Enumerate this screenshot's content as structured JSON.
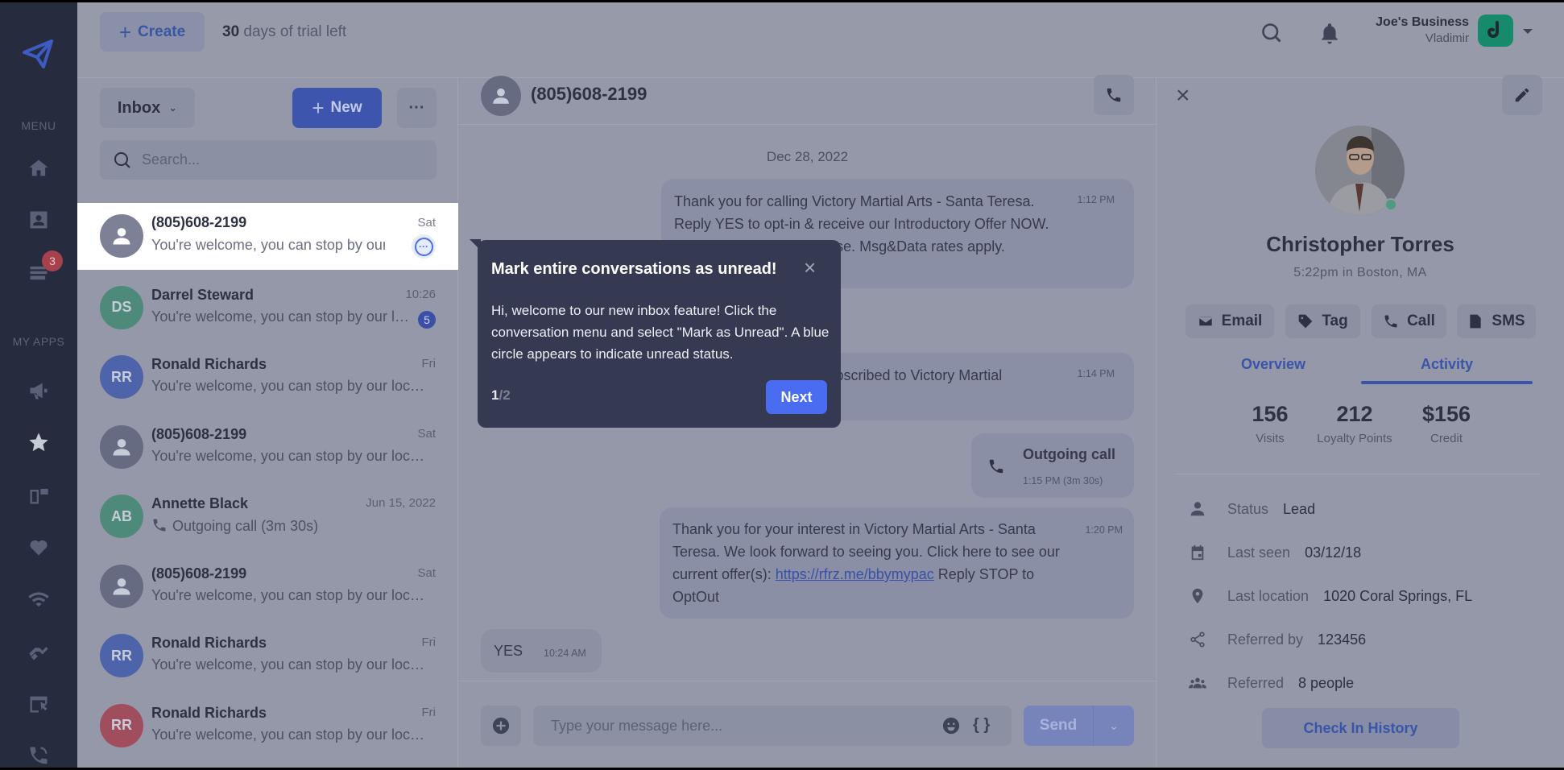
{
  "header": {
    "create_label": "Create",
    "trial_count": "30",
    "trial_text": "days of trial left",
    "business": "Joe's Business",
    "user": "Vladimir"
  },
  "sidebar": {
    "menu_label": "MENU",
    "apps_label": "MY APPS",
    "menu_icons": [
      "home-icon",
      "contacts-icon",
      "inbox-icon"
    ],
    "inbox_badge": "3",
    "app_icons": [
      "megaphone-icon",
      "star-icon",
      "devices-icon",
      "heart-icon",
      "wifi-icon",
      "handshake-icon",
      "browser-click-icon",
      "phone-callback-icon"
    ]
  },
  "inbox": {
    "folder_label": "Inbox",
    "new_label": "New",
    "search_placeholder": "Search...",
    "conversations": [
      {
        "name": "(805)608-2199",
        "preview": "You're welcome, you can stop by our location",
        "time": "Sat",
        "avatar": "person",
        "color": "#7d8196",
        "selected": true
      },
      {
        "name": "Darrel Steward",
        "preview": "You're welcome, you can stop by our location",
        "time": "10:26",
        "initials": "DS",
        "color": "#4e8a7a",
        "unread": "5"
      },
      {
        "name": "Ronald Richards",
        "preview": "You're welcome, you can stop by our location",
        "time": "Fri",
        "initials": "RR",
        "color": "#4d64ab"
      },
      {
        "name": "(805)608-2199",
        "preview": "You're welcome, you can stop by our location",
        "time": "Sat",
        "avatar": "person",
        "color": "#666b82"
      },
      {
        "name": "Annette Black",
        "preview": "Outgoing call (3m 30s)",
        "time": "Jun 15, 2022",
        "initials": "AB",
        "color": "#4e8a7a",
        "call": true
      },
      {
        "name": "(805)608-2199",
        "preview": "You're welcome, you can stop by our location",
        "time": "Sat",
        "avatar": "person",
        "color": "#666b82"
      },
      {
        "name": "Ronald Richards",
        "preview": "You're welcome, you can stop by our location",
        "time": "Fri",
        "initials": "RR",
        "color": "#4d64ab"
      },
      {
        "name": "Ronald Richards",
        "preview": "You're welcome, you can stop by our location",
        "time": "Fri",
        "initials": "RR",
        "color": "#a04e5e"
      }
    ]
  },
  "chat": {
    "contact": "(805)608-2199",
    "date": "Dec 28, 2022",
    "messages": {
      "m1": {
        "text": "Thank you for calling Victory Martial Arts - Santa Teresa. Reply YES to opt-in & receive our Introductory Offer NOW. Opt-in not req. for purchase. Msg&Data rates apply.",
        "time": "1:12 PM"
      },
      "m2": {
        "text": "You have successfully subscribed to Victory Martial",
        "time": "1:14 PM"
      },
      "call": {
        "title": "Outgoing call",
        "sub": "1:15 PM (3m 30s)"
      },
      "m4": {
        "before": "Thank you for your interest in Victory Martial Arts - Santa Teresa. We look forward to seeing you. Click here to see our current offer(s): ",
        "link": "https://rfrz.me/bbymypac",
        "after": " Reply STOP to OptOut",
        "time": "1:20 PM"
      },
      "m5": {
        "text": "YES",
        "time": "10:24 AM"
      }
    },
    "composer_placeholder": "Type your message here...",
    "vars_label": "{ }",
    "send_label": "Send"
  },
  "contact": {
    "name": "Christopher Torres",
    "local": "5:22pm in Boston, MA",
    "online_color": "#4e9b80",
    "actions": [
      "Email",
      "Tag",
      "Call",
      "SMS"
    ],
    "tabs": {
      "overview": "Overview",
      "activity": "Activity",
      "active": "Activity"
    },
    "stats": [
      {
        "value": "156",
        "label": "Visits"
      },
      {
        "value": "212",
        "label": "Loyalty Points"
      },
      {
        "value": "$156",
        "label": "Credit"
      }
    ],
    "info": [
      {
        "icon": "person-icon",
        "label": "Status",
        "value": "Lead"
      },
      {
        "icon": "calendar-icon",
        "label": "Last seen",
        "value": "03/12/18"
      },
      {
        "icon": "location-pin-icon",
        "label": "Last location",
        "value": "1020 Coral Springs, FL"
      },
      {
        "icon": "share-icon",
        "label": "Referred by",
        "value": "123456"
      },
      {
        "icon": "group-icon",
        "label": "Referred",
        "value": "8 people"
      }
    ],
    "history_label": "Check In History"
  },
  "tooltip": {
    "title": "Mark entire conversations as unread!",
    "body": "Hi, welcome to our new inbox feature! Click the conversation menu and select \"Mark as Unread\". A blue circle appears to indicate unread status.",
    "step": "1",
    "total": "/2",
    "next_label": "Next"
  },
  "colors": {
    "accent": "#4a6cf0",
    "overlay_bg": "#9598a8",
    "sidebar": "#262b3e",
    "tooltip": "#353a52"
  }
}
